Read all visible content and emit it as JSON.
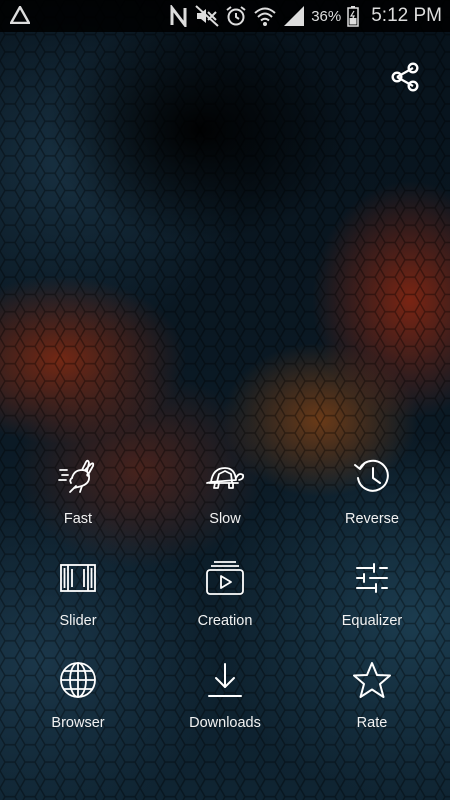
{
  "status_bar": {
    "battery_percent": "36%",
    "time": "5:12 PM",
    "icons": [
      "warning-icon",
      "n-notification-icon",
      "mute-icon",
      "alarm-icon",
      "wifi-icon",
      "signal-icon",
      "battery-icon"
    ]
  },
  "toolbar": {
    "share_icon": "share-icon"
  },
  "menu": {
    "items": [
      {
        "label": "Fast",
        "icon": "rabbit-icon"
      },
      {
        "label": "Slow",
        "icon": "turtle-icon"
      },
      {
        "label": "Reverse",
        "icon": "history-icon"
      },
      {
        "label": "Slider",
        "icon": "film-slider-icon"
      },
      {
        "label": "Creation",
        "icon": "video-library-icon"
      },
      {
        "label": "Equalizer",
        "icon": "equalizer-icon"
      },
      {
        "label": "Browser",
        "icon": "globe-icon"
      },
      {
        "label": "Downloads",
        "icon": "download-icon"
      },
      {
        "label": "Rate",
        "icon": "star-icon"
      }
    ]
  }
}
